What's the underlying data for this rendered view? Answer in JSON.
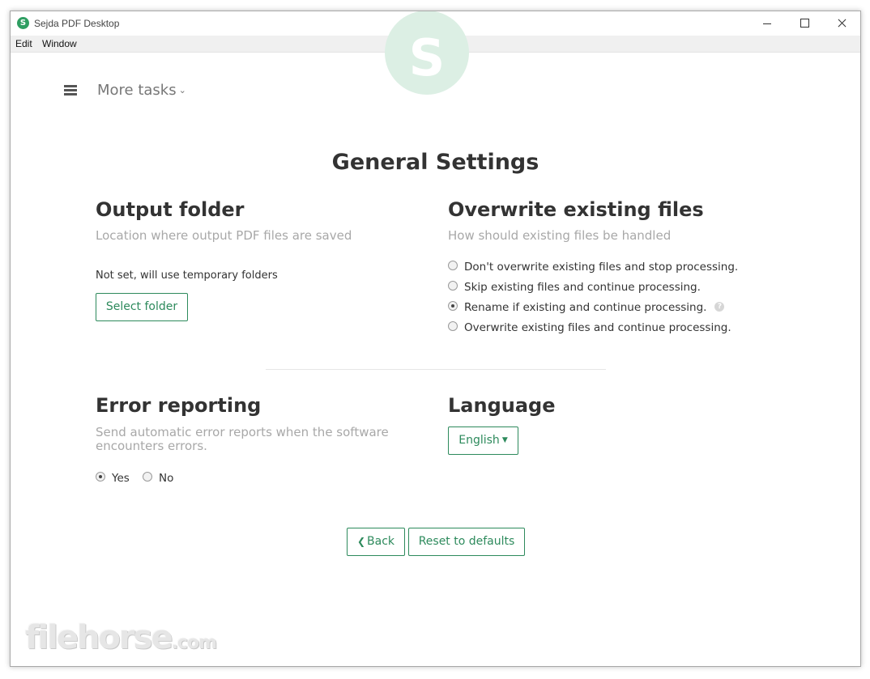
{
  "window": {
    "title": "Sejda PDF Desktop",
    "app_icon_letter": "S"
  },
  "menu": {
    "items": [
      "Edit",
      "Window"
    ]
  },
  "toolbar": {
    "more_tasks": "More tasks",
    "caret": "⌄"
  },
  "logo": {
    "letter": "S"
  },
  "page_title": "General Settings",
  "output_folder": {
    "title": "Output folder",
    "subtitle": "Location where output PDF files are saved",
    "status": "Not set, will use temporary folders",
    "button": "Select folder"
  },
  "overwrite": {
    "title": "Overwrite existing files",
    "subtitle": "How should existing files be handled",
    "options": [
      {
        "label": "Don't overwrite existing files and stop processing.",
        "selected": false
      },
      {
        "label": "Skip existing files and continue processing.",
        "selected": false
      },
      {
        "label": "Rename if existing and continue processing.",
        "selected": true
      },
      {
        "label": "Overwrite existing files and continue processing.",
        "selected": false
      }
    ],
    "help_icon": "?"
  },
  "error_reporting": {
    "title": "Error reporting",
    "subtitle_line1": "Send automatic error reports when the software",
    "subtitle_line2": "encounters errors.",
    "options": [
      {
        "label": "Yes",
        "selected": true
      },
      {
        "label": "No",
        "selected": false
      }
    ]
  },
  "language": {
    "title": "Language",
    "selected": "English"
  },
  "actions": {
    "back": "Back",
    "reset": "Reset to defaults"
  },
  "watermark": {
    "text": "filehorse",
    "suffix": ".com"
  },
  "colors": {
    "accent": "#2d8a5c",
    "brand": "#2f9e62",
    "muted": "#a8a8a8"
  }
}
